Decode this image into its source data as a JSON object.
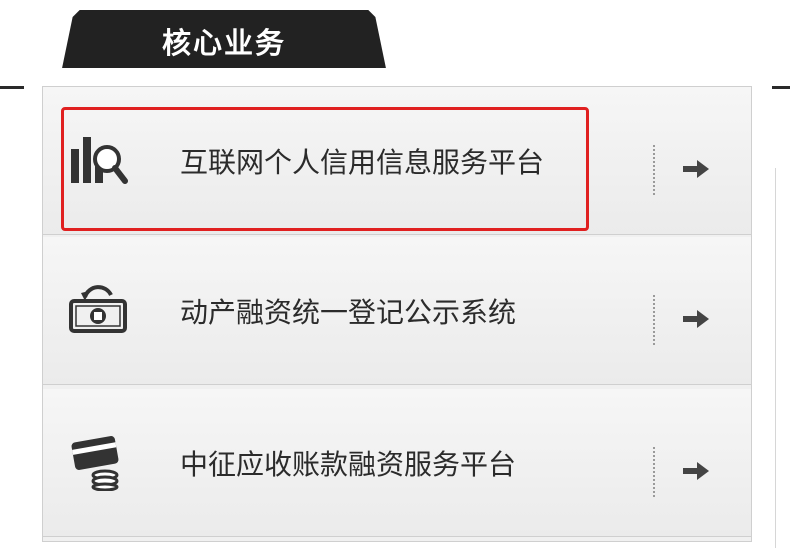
{
  "header": {
    "tab_title": "核心业务"
  },
  "services": [
    {
      "label": "互联网个人信用信息服务平台",
      "icon": "credit-chart-search-icon",
      "highlighted": true
    },
    {
      "label": "动产融资统一登记公示系统",
      "icon": "money-cycle-icon",
      "highlighted": false
    },
    {
      "label": "中征应收账款融资服务平台",
      "icon": "card-coins-icon",
      "highlighted": false
    }
  ],
  "colors": {
    "tab_background": "#222222",
    "highlight_border": "#e02020",
    "row_text": "#2b2b2b"
  }
}
